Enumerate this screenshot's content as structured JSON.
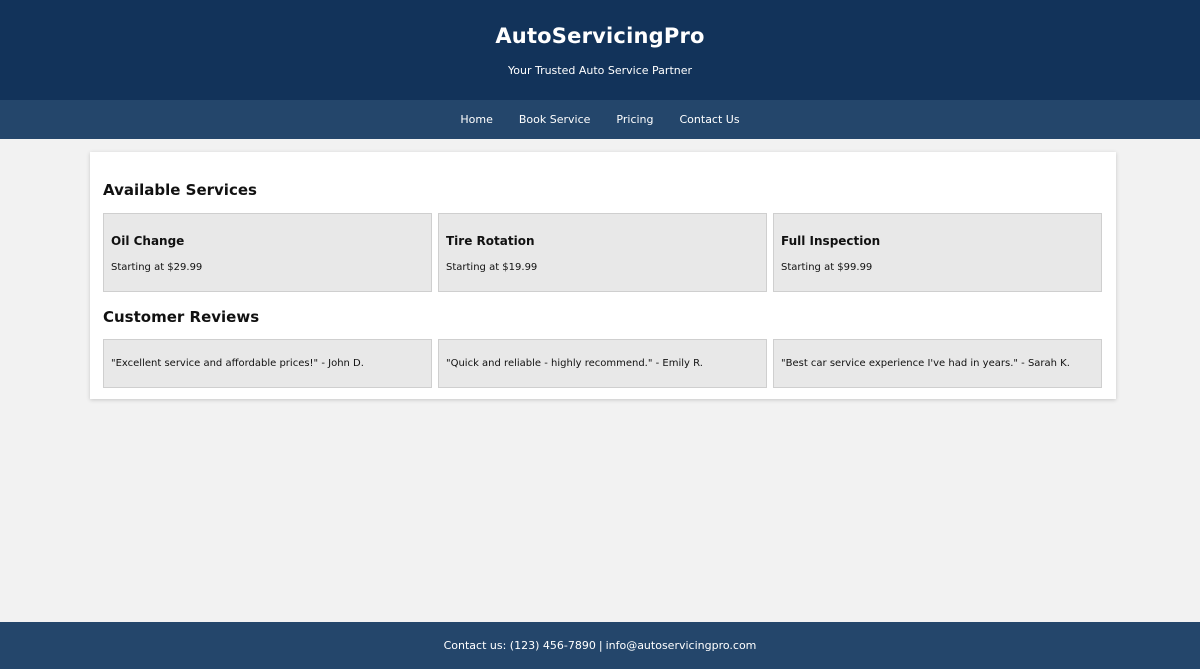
{
  "header": {
    "title": "AutoServicingPro",
    "tagline": "Your Trusted Auto Service Partner"
  },
  "nav": {
    "items": [
      {
        "label": "Home"
      },
      {
        "label": "Book Service"
      },
      {
        "label": "Pricing"
      },
      {
        "label": "Contact Us"
      }
    ]
  },
  "services": {
    "title": "Available Services",
    "items": [
      {
        "name": "Oil Change",
        "price": "Starting at $29.99"
      },
      {
        "name": "Tire Rotation",
        "price": "Starting at $19.99"
      },
      {
        "name": "Full Inspection",
        "price": "Starting at $99.99"
      }
    ]
  },
  "reviews": {
    "title": "Customer Reviews",
    "items": [
      {
        "text": "\"Excellent service and affordable prices!\" - John D."
      },
      {
        "text": "\"Quick and reliable - highly recommend.\" - Emily R."
      },
      {
        "text": "\"Best car service experience I've had in years.\" - Sarah K."
      }
    ]
  },
  "footer": {
    "phone_text": "Contact us: (123) 456-7890",
    "separator": "|",
    "email": "info@autoservicingpro.com"
  },
  "colors": {
    "header_bg": "#12335a",
    "nav_bg": "#24466b",
    "footer_bg": "#24466b",
    "page_bg": "#f2f2f2",
    "box_bg": "#e8e8e8"
  }
}
